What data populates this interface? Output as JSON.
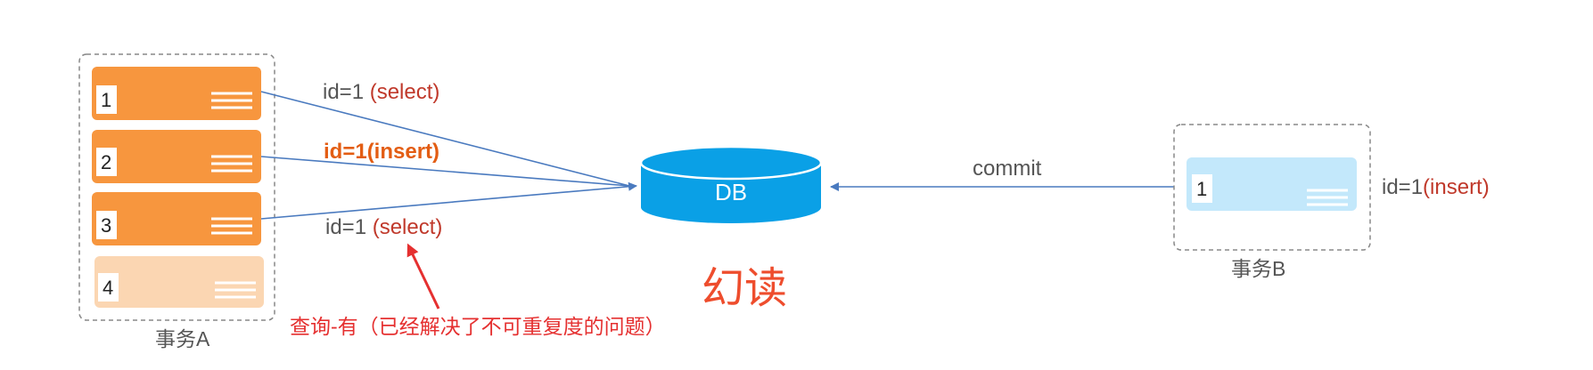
{
  "transaction_a": {
    "label": "事务A",
    "rows": [
      {
        "number": "1",
        "state": "solid"
      },
      {
        "number": "2",
        "state": "solid"
      },
      {
        "number": "3",
        "state": "solid"
      },
      {
        "number": "4",
        "state": "faded"
      }
    ]
  },
  "transaction_b": {
    "label": "事务B",
    "rows": [
      {
        "number": "1"
      }
    ],
    "operation": {
      "prefix": "id=1",
      "action": "(insert)"
    }
  },
  "arrows": {
    "select_1": {
      "prefix": "id=1 ",
      "action": "(select)"
    },
    "insert": {
      "text": "id=1(insert)"
    },
    "select_2": {
      "prefix": "id=1 ",
      "action": "(select)"
    },
    "commit": "commit"
  },
  "db": {
    "label": "DB"
  },
  "title": "幻读",
  "annotation": "查询-有（已经解决了不可重复度的问题）",
  "colors": {
    "row_solid": "#f7963e",
    "row_faded": "#fbd6b2",
    "row_b": "#c3e8fb",
    "db": "#0aa0e6",
    "arrow": "#4a7abf",
    "red_text": "#c0392b",
    "orange_text": "#e35d13",
    "title": "#ee4d2d",
    "annotation": "#e53030"
  }
}
